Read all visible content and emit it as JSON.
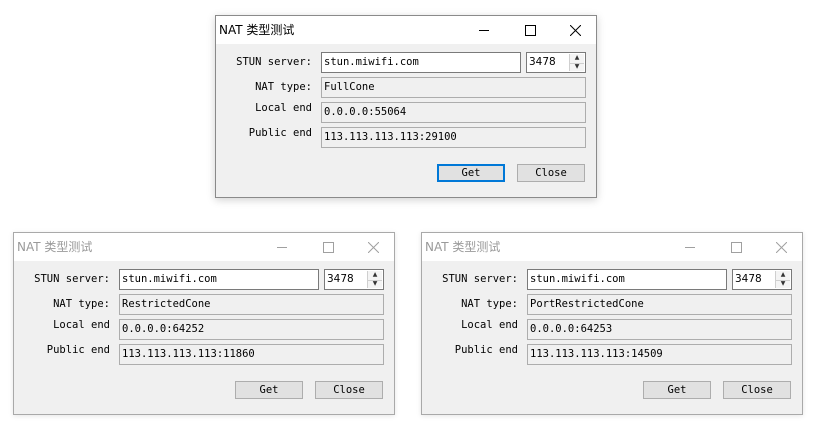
{
  "windows": [
    {
      "title": "NAT 类型测试",
      "labels": {
        "server": "STUN server:",
        "nat_type": "NAT type:",
        "local": "Local end",
        "public": "Public end"
      },
      "server": "stun.miwifi.com",
      "port": "3478",
      "nat_type": "FullCone",
      "local_end": "0.0.0.0:55064",
      "public_end": "113.113.113.113:29100",
      "get_label": "Get",
      "close_label": "Close"
    },
    {
      "title": "NAT 类型测试",
      "labels": {
        "server": "STUN server:",
        "nat_type": "NAT type:",
        "local": "Local end",
        "public": "Public end"
      },
      "server": "stun.miwifi.com",
      "port": "3478",
      "nat_type": "RestrictedCone",
      "local_end": "0.0.0.0:64252",
      "public_end": "113.113.113.113:11860",
      "get_label": "Get",
      "close_label": "Close"
    },
    {
      "title": "NAT 类型测试",
      "labels": {
        "server": "STUN server:",
        "nat_type": "NAT type:",
        "local": "Local end",
        "public": "Public end"
      },
      "server": "stun.miwifi.com",
      "port": "3478",
      "nat_type": "PortRestrictedCone",
      "local_end": "0.0.0.0:64253",
      "public_end": "113.113.113.113:14509",
      "get_label": "Get",
      "close_label": "Close"
    }
  ],
  "icons": {
    "minimize": "minimize-icon",
    "maximize": "maximize-icon",
    "close": "close-icon",
    "spin_up": "spin-up-icon",
    "spin_down": "spin-down-icon"
  }
}
